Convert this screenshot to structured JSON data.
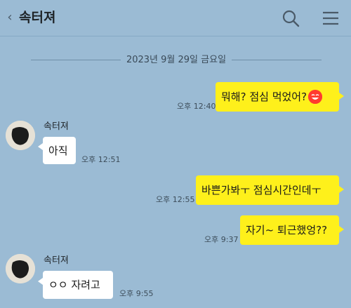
{
  "header": {
    "back_glyph": "‹",
    "title": "속터져",
    "back_icon": "back-chevron-icon",
    "search_icon": "search-icon",
    "menu_icon": "hamburger-menu-icon"
  },
  "date_divider": "2023년 9월 29일 금요일",
  "messages": [
    {
      "from": "me",
      "text": "뭐해? 점심 먹었어?",
      "time": "오후 12:40",
      "emoji": "laughing-face-emoji"
    },
    {
      "from": "them",
      "sender": "속터져",
      "text": "아직",
      "time": "오후 12:51"
    },
    {
      "from": "me",
      "text": "바쁜가봐ㅜ 점심시간인데ㅜ",
      "time": "오후 12:55"
    },
    {
      "from": "me",
      "text": "자기~ 퇴근했엉??",
      "time": "오후 9:37"
    },
    {
      "from": "them",
      "sender": "속터져",
      "text": "ㅇㅇ 자려고",
      "time": "오후 9:55"
    }
  ],
  "colors": {
    "background": "#9bbbd4",
    "my_bubble": "#fef01b",
    "their_bubble": "#ffffff"
  }
}
